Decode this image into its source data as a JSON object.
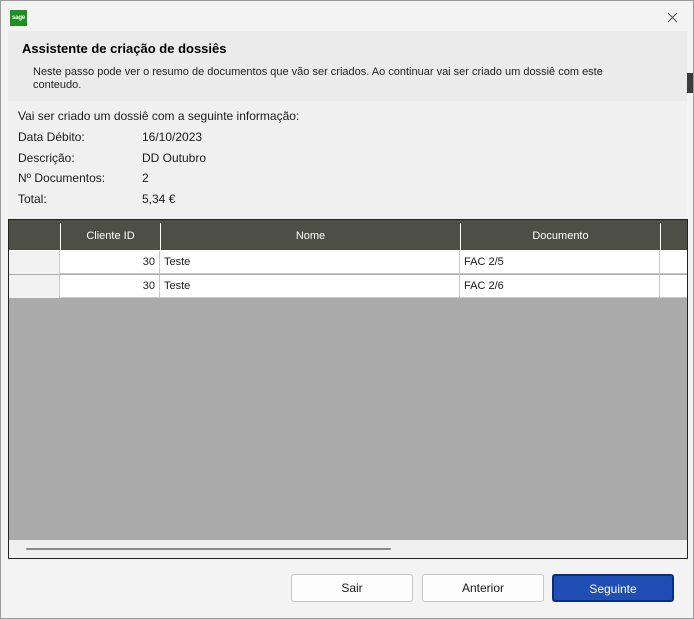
{
  "app": {
    "icon_text": "sage",
    "close_glyph": "✕"
  },
  "header": {
    "title": "Assistente de criação de dossiês",
    "description": "Neste passo pode ver o resumo de documentos que vão ser criados. Ao continuar vai ser criado um dossiê com este conteudo."
  },
  "info": {
    "intro": "Vai ser criado um dossiê com a seguinte informação:",
    "rows": [
      {
        "label": "Data Débito:",
        "value": "16/10/2023"
      },
      {
        "label": "Descrição:",
        "value": "DD Outubro"
      },
      {
        "label": "Nº Documentos:",
        "value": "2"
      },
      {
        "label": "Total:",
        "value": "5,34 €"
      }
    ]
  },
  "grid": {
    "columns": [
      "Cliente ID",
      "Nome",
      "Documento"
    ],
    "rows": [
      {
        "cliente_id": "30",
        "nome": "Teste",
        "documento": "FAC 2/5"
      },
      {
        "cliente_id": "30",
        "nome": "Teste",
        "documento": "FAC 2/6"
      }
    ]
  },
  "buttons": {
    "exit": "Sair",
    "previous": "Anterior",
    "next": "Seguinte"
  },
  "colors": {
    "brand": "#1f8f1f",
    "grid_header": "#4d4e44",
    "primary_button": "#1f4fb4"
  }
}
